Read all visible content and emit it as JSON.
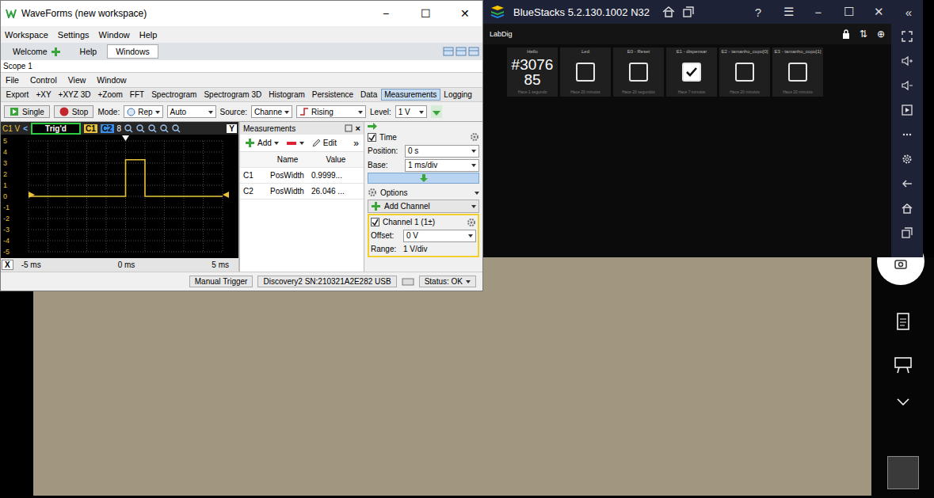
{
  "waveforms": {
    "title": "WaveForms (new workspace)",
    "window_buttons": [
      "−",
      "☐",
      "✕"
    ],
    "menu": [
      "Workspace",
      "Settings",
      "Window",
      "Help"
    ],
    "tabs": [
      {
        "label": "Welcome",
        "selected": false
      },
      {
        "label": "Help",
        "selected": false
      },
      {
        "label": "Windows",
        "selected": true
      }
    ],
    "scope_title": "Scope 1",
    "scope_menu": [
      "File",
      "Control",
      "View",
      "Window"
    ],
    "toolbar": [
      {
        "label": "Export",
        "selected": false
      },
      {
        "label": "+XY",
        "selected": false
      },
      {
        "label": "+XYZ 3D",
        "selected": false
      },
      {
        "label": "+Zoom",
        "selected": false
      },
      {
        "label": "FFT",
        "selected": false
      },
      {
        "label": "Spectrogram",
        "selected": false
      },
      {
        "label": "Spectrogram 3D",
        "selected": false
      },
      {
        "label": "Histogram",
        "selected": false
      },
      {
        "label": "Persistence",
        "selected": false
      },
      {
        "label": "Data",
        "selected": false
      },
      {
        "label": "Measurements",
        "selected": true
      },
      {
        "label": "Logging",
        "selected": false
      }
    ],
    "controls": {
      "single": "Single",
      "stop": "Stop",
      "mode_label": "Mode:",
      "mode": "Rep",
      "mode2": "Auto",
      "source_label": "Source:",
      "source": "Channe",
      "edge": "Rising",
      "level_label": "Level:",
      "level": "1 V"
    },
    "plot": {
      "channel_unit": "C1 V",
      "prev": "<",
      "trigger_status": "Trig'd",
      "channels": [
        {
          "label": "C1",
          "color": "#e8c23a"
        },
        {
          "label": "C2",
          "color": "#3a8ee8"
        }
      ],
      "extra": "8",
      "y_button": "Y",
      "y_ticks": [
        "5",
        "4",
        "3",
        "2",
        "1",
        "0",
        "-1",
        "-2",
        "-3",
        "-4",
        "-5"
      ],
      "x_button": "X",
      "x_ticks": [
        "-5 ms",
        "0 ms",
        "5 ms"
      ],
      "series": [
        {
          "name": "C1",
          "color": "#e8c23a",
          "time_ms": [
            -5,
            0,
            0,
            1,
            1,
            5
          ],
          "values": [
            0,
            0,
            3.3,
            3.3,
            0,
            0
          ]
        }
      ]
    },
    "measurements": {
      "title": "Measurements",
      "close": "×",
      "add": "Add",
      "edit": "Edit",
      "more": "»",
      "columns": [
        "",
        "Name",
        "Value"
      ],
      "rows": [
        [
          "C1",
          "PosWidth",
          "0.9999..."
        ],
        [
          "C2",
          "PosWidth",
          "26.046 ..."
        ]
      ]
    },
    "settings": {
      "time": {
        "label": "Time",
        "checked": true
      },
      "position_label": "Position:",
      "position": "0 s",
      "base_label": "Base:",
      "base": "1 ms/div",
      "options": "Options",
      "add_channel": "Add Channel",
      "channel": {
        "label": "Channel 1 (1±)",
        "checked": true
      },
      "offset_label": "Offset:",
      "offset": "0 V",
      "range_label": "Range:",
      "range": "1 V/div"
    },
    "status_bar": {
      "trigger": "Manual Trigger",
      "device": "Discovery2 SN:210321A2E282 USB",
      "status": "Status: OK"
    }
  },
  "bluestacks": {
    "title": "BlueStacks 5.2.130.1002 N32",
    "window_buttons": [
      "?",
      "☰",
      "−",
      "☐",
      "✕",
      "«"
    ],
    "app_title": "LabDig",
    "app_icons": [
      "⇅",
      "⊕"
    ],
    "tiles": [
      {
        "label": "Hello",
        "kind": "value",
        "value": "#307685",
        "time": "Hace 1 segundo"
      },
      {
        "label": "Led",
        "kind": "checkbox",
        "checked": false,
        "time": "Hace 20 minutos"
      },
      {
        "label": "E0 - Reset",
        "kind": "checkbox",
        "checked": false,
        "time": "Hace 20 segundos"
      },
      {
        "label": "E1 - dispensar",
        "kind": "checkbox",
        "checked": true,
        "time": "Hace 7 minutos"
      },
      {
        "label": "E2 - tamanho_copo[0]",
        "kind": "checkbox",
        "checked": false,
        "time": "Hace 20 minutos"
      },
      {
        "label": "E3 - tamanho_copo[1]",
        "kind": "checkbox",
        "checked": false,
        "time": "Hace 20 minutos"
      }
    ]
  }
}
